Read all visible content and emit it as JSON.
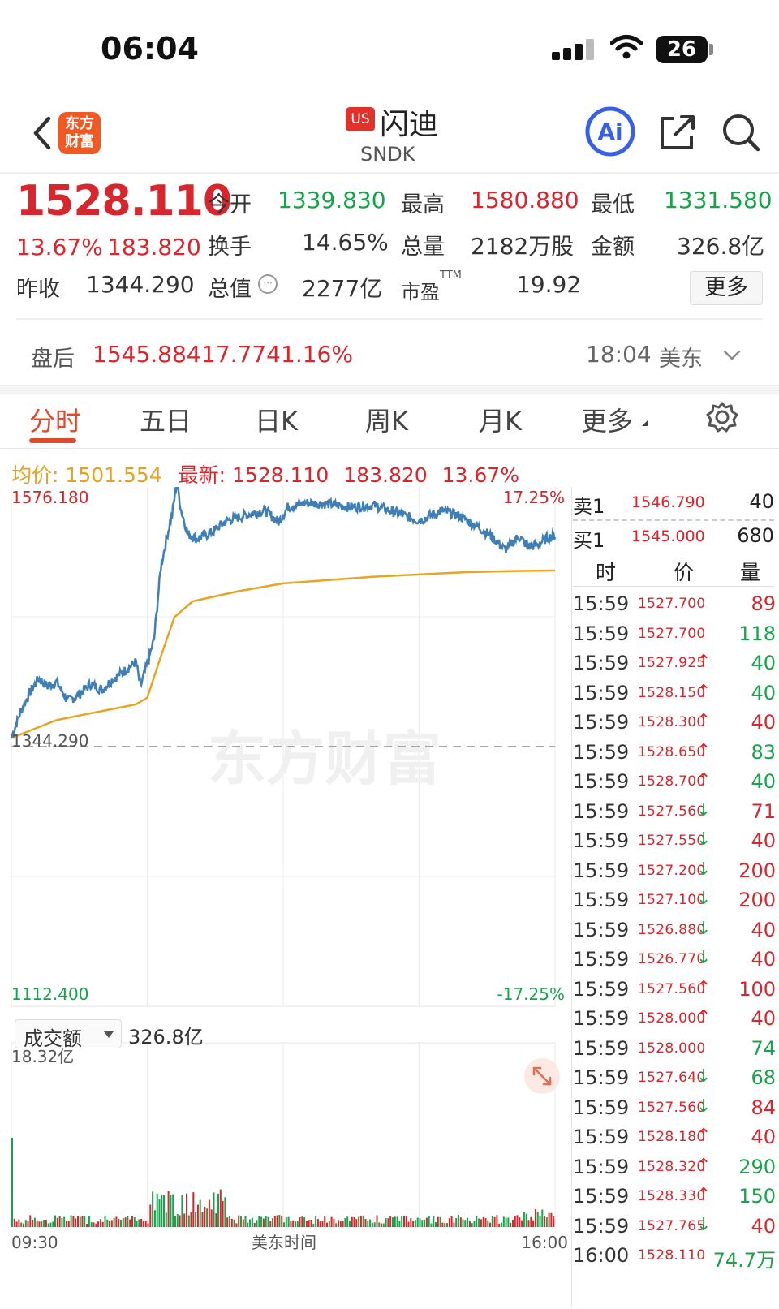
{
  "status_bar": {
    "time": "06:04",
    "battery": "26"
  },
  "header": {
    "logo_text": "东方财富",
    "market_badge": "US",
    "name": "闪迪",
    "code": "SNDK",
    "ai_label": "Ai"
  },
  "quote": {
    "price": "1528.110",
    "change_pct": "13.67%",
    "change": "183.820",
    "prev_close_label": "昨收",
    "prev_close": "1344.290",
    "open_label": "今开",
    "open": "1339.830",
    "high_label": "最高",
    "high": "1580.880",
    "low_label": "最低",
    "low": "1331.580",
    "turnover_label": "换手",
    "turnover": "14.65%",
    "volume_label": "总量",
    "volume": "2182万股",
    "amount_label": "金额",
    "amount": "326.8亿",
    "mktcap_label": "总值",
    "mktcap": "2277亿",
    "pe_label": "市盈",
    "pe_sup": "TTM",
    "pe": "19.92",
    "more_label": "更多"
  },
  "after_hours": {
    "label": "盘后",
    "price": "1545.884",
    "change": "17.774",
    "change_pct": "1.16%",
    "time": "18:04",
    "zone": "美东"
  },
  "tabs": [
    "分时",
    "五日",
    "日K",
    "周K",
    "月K",
    "更多"
  ],
  "active_tab": "分时",
  "avg_info": {
    "avg_label": "均价:",
    "avg": "1501.554",
    "latest_label": "最新:",
    "latest": "1528.110",
    "change": "183.820",
    "change_pct": "13.67%"
  },
  "chart_labels": {
    "top_price": "1576.180",
    "top_pct": "17.25%",
    "ref_price": "1344.290",
    "bottom_price": "1112.400",
    "bottom_pct": "-17.25%",
    "watermark": "东方财富",
    "volume_selector": "成交额",
    "volume_total": "326.8亿",
    "volume_max": "18.32亿",
    "x_start": "09:30",
    "x_mid": "美东时间",
    "x_end": "16:00"
  },
  "colors": {
    "price_line": "#3f7fb5",
    "avg_line": "#e8a422",
    "up": "#d9262d",
    "down": "#17a34a"
  },
  "chart_data": {
    "type": "line",
    "title": "",
    "xlabel": "美东时间",
    "ylabel": "",
    "x_range": [
      "09:30",
      "16:00"
    ],
    "ylim": [
      1112.4,
      1576.18
    ],
    "reference": 1344.29,
    "series": [
      {
        "name": "",
        "points": [
          [
            0,
            1352
          ],
          [
            4,
            1375
          ],
          [
            8,
            1392
          ],
          [
            12,
            1405
          ],
          [
            16,
            1398
          ],
          [
            20,
            1402
          ],
          [
            25,
            1385
          ],
          [
            30,
            1391
          ],
          [
            35,
            1400
          ],
          [
            40,
            1395
          ],
          [
            45,
            1405
          ],
          [
            50,
            1412
          ],
          [
            55,
            1420
          ],
          [
            57,
            1398
          ],
          [
            60,
            1418
          ],
          [
            63,
            1440
          ],
          [
            66,
            1505
          ],
          [
            69,
            1535
          ],
          [
            71,
            1552
          ],
          [
            73,
            1580
          ],
          [
            75,
            1555
          ],
          [
            78,
            1534
          ],
          [
            82,
            1530
          ],
          [
            88,
            1535
          ],
          [
            95,
            1546
          ],
          [
            105,
            1552
          ],
          [
            112,
            1555
          ],
          [
            118,
            1545
          ],
          [
            122,
            1558
          ],
          [
            130,
            1562
          ],
          [
            140,
            1561
          ],
          [
            150,
            1558
          ],
          [
            160,
            1560
          ],
          [
            170,
            1553
          ],
          [
            180,
            1546
          ],
          [
            190,
            1555
          ],
          [
            198,
            1550
          ],
          [
            205,
            1542
          ],
          [
            212,
            1532
          ],
          [
            218,
            1520
          ],
          [
            224,
            1532
          ],
          [
            228,
            1523
          ],
          [
            232,
            1524
          ],
          [
            236,
            1530
          ],
          [
            240,
            1533
          ]
        ]
      },
      {
        "name": "均价",
        "points": [
          [
            0,
            1352
          ],
          [
            20,
            1368
          ],
          [
            40,
            1376
          ],
          [
            55,
            1382
          ],
          [
            60,
            1388
          ],
          [
            66,
            1425
          ],
          [
            72,
            1460
          ],
          [
            80,
            1474
          ],
          [
            100,
            1483
          ],
          [
            120,
            1490
          ],
          [
            140,
            1493
          ],
          [
            160,
            1496
          ],
          [
            180,
            1498
          ],
          [
            200,
            1500
          ],
          [
            220,
            1501
          ],
          [
            240,
            1501.554
          ]
        ]
      }
    ]
  },
  "order_book": {
    "sell": {
      "label": "卖1",
      "price": "1546.790",
      "qty": "40"
    },
    "buy": {
      "label": "买1",
      "price": "1545.000",
      "qty": "680"
    },
    "headers": [
      "时",
      "价",
      "量"
    ]
  },
  "trades": [
    {
      "time": "15:59",
      "price": "1527.700",
      "arrow": "",
      "vol": "89",
      "dir": "down"
    },
    {
      "time": "15:59",
      "price": "1527.700",
      "arrow": "",
      "vol": "118",
      "dir": "up"
    },
    {
      "time": "15:59",
      "price": "1527.925",
      "arrow": "↑",
      "vol": "40",
      "dir": "up"
    },
    {
      "time": "15:59",
      "price": "1528.150",
      "arrow": "↑",
      "vol": "40",
      "dir": "up"
    },
    {
      "time": "15:59",
      "price": "1528.300",
      "arrow": "↑",
      "vol": "40",
      "dir": "down"
    },
    {
      "time": "15:59",
      "price": "1528.650",
      "arrow": "↑",
      "vol": "83",
      "dir": "up"
    },
    {
      "time": "15:59",
      "price": "1528.700",
      "arrow": "↑",
      "vol": "40",
      "dir": "up"
    },
    {
      "time": "15:59",
      "price": "1527.560",
      "arrow": "↓",
      "vol": "71",
      "dir": "down"
    },
    {
      "time": "15:59",
      "price": "1527.550",
      "arrow": "↓",
      "vol": "40",
      "dir": "down"
    },
    {
      "time": "15:59",
      "price": "1527.200",
      "arrow": "↓",
      "vol": "200",
      "dir": "down"
    },
    {
      "time": "15:59",
      "price": "1527.100",
      "arrow": "↓",
      "vol": "200",
      "dir": "down"
    },
    {
      "time": "15:59",
      "price": "1526.880",
      "arrow": "↓",
      "vol": "40",
      "dir": "down"
    },
    {
      "time": "15:59",
      "price": "1526.770",
      "arrow": "↓",
      "vol": "40",
      "dir": "down"
    },
    {
      "time": "15:59",
      "price": "1527.560",
      "arrow": "↑",
      "vol": "100",
      "dir": "down"
    },
    {
      "time": "15:59",
      "price": "1528.000",
      "arrow": "↑",
      "vol": "40",
      "dir": "down"
    },
    {
      "time": "15:59",
      "price": "1528.000",
      "arrow": "",
      "vol": "74",
      "dir": "up"
    },
    {
      "time": "15:59",
      "price": "1527.640",
      "arrow": "↓",
      "vol": "68",
      "dir": "up"
    },
    {
      "time": "15:59",
      "price": "1527.560",
      "arrow": "↓",
      "vol": "84",
      "dir": "down"
    },
    {
      "time": "15:59",
      "price": "1528.180",
      "arrow": "↑",
      "vol": "40",
      "dir": "down"
    },
    {
      "time": "15:59",
      "price": "1528.320",
      "arrow": "↑",
      "vol": "290",
      "dir": "up"
    },
    {
      "time": "15:59",
      "price": "1528.330",
      "arrow": "↑",
      "vol": "150",
      "dir": "up"
    },
    {
      "time": "15:59",
      "price": "1527.765",
      "arrow": "↓",
      "vol": "40",
      "dir": "down"
    },
    {
      "time": "16:00",
      "price": "1528.110",
      "arrow": "",
      "vol": "74.7万",
      "dir": "up"
    }
  ]
}
